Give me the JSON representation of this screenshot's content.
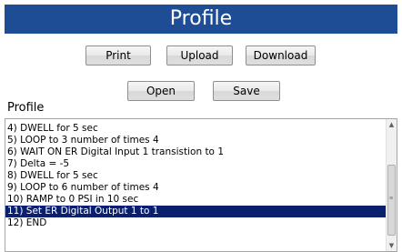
{
  "header": {
    "title": "Profile"
  },
  "toolbar": {
    "print_label": "Print",
    "upload_label": "Upload",
    "download_label": "Download",
    "open_label": "Open",
    "save_label": "Save"
  },
  "profile_section": {
    "label": "Profile"
  },
  "profile_list": {
    "items": [
      "4) DWELL for 5 sec",
      "5) LOOP to 3 number of times 4",
      "6) WAIT ON ER Digital Input 1 transistion to 1",
      "7) Delta = -5",
      "8) DWELL for 5 sec",
      "9) LOOP to 6 number of times 4",
      "10) RAMP to 0 PSI in 10 sec",
      "11) Set ER Digital Output 1 to 1",
      "12) END"
    ],
    "selected_index": 7
  },
  "icons": {
    "scroll_up": "triangle-up",
    "scroll_down": "triangle-down",
    "thumb_grip": "grip-lines"
  },
  "colors": {
    "header_background": "#1f4d95",
    "header_text": "#ffffff",
    "selection_background": "#0a1f6e",
    "selection_text": "#ffffff"
  }
}
